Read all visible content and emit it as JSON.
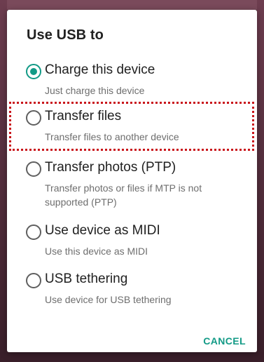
{
  "dialog": {
    "title": "Use USB to",
    "options": [
      {
        "label": "Charge this device",
        "description": "Just charge this device",
        "selected": true
      },
      {
        "label": "Transfer files",
        "description": "Transfer files to another device",
        "selected": false
      },
      {
        "label": "Transfer photos (PTP)",
        "description": "Transfer photos or files if MTP is not supported (PTP)",
        "selected": false
      },
      {
        "label": "Use device as MIDI",
        "description": "Use this device as MIDI",
        "selected": false
      },
      {
        "label": "USB tethering",
        "description": "Use device for USB tethering",
        "selected": false
      }
    ],
    "cancel_label": "CANCEL"
  },
  "colors": {
    "accent": "#129a86",
    "highlight": "#c9151b",
    "background": "#4a2a35"
  }
}
